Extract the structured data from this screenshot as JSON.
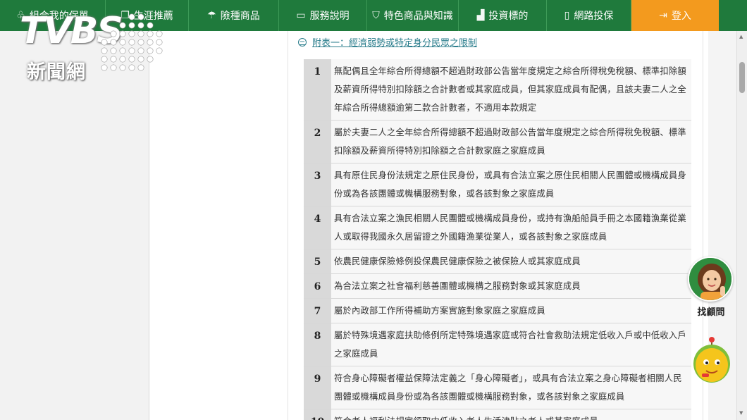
{
  "nav": {
    "items": [
      {
        "label": "組合我的保單",
        "icon": "people-icon",
        "width": 150
      },
      {
        "label": "生涯推薦",
        "icon": "book-icon",
        "width": 118
      },
      {
        "label": "險種商品",
        "icon": "umbrella-icon",
        "width": 128
      },
      {
        "label": "服務說明",
        "icon": "card-icon",
        "width": 125
      },
      {
        "label": "特色商品與知識",
        "icon": "shield-icon",
        "width": 130
      },
      {
        "label": "投資標的",
        "icon": "chart-icon",
        "width": 125
      },
      {
        "label": "網路投保",
        "icon": "phone-icon",
        "width": 120
      }
    ],
    "login_label": "登入"
  },
  "logo": {
    "brand": "TVBS",
    "sub": "新聞網"
  },
  "appendix": {
    "title": "附表一：經濟弱勢或特定身分民眾之限制"
  },
  "table": {
    "rows": [
      {
        "num": "1",
        "text": "無配偶且全年綜合所得總額不超過財政部公告當年度規定之綜合所得稅免稅額、標準扣除額及薪資所得特別扣除額之合計數者或其家庭成員，但其家庭成員有配偶，且該夫妻二人之全年綜合所得總額逾第二款合計數者，不適用本款規定"
      },
      {
        "num": "2",
        "text": "屬於夫妻二人之全年綜合所得總額不超過財政部公告當年度規定之綜合所得稅免稅額、標準扣除額及薪資所得特別扣除額之合計數家庭之家庭成員"
      },
      {
        "num": "3",
        "text": "具有原住民身份法規定之原住民身份，或具有合法立案之原住民相關人民團體或機構成員身份或為各該團體或機構服務對象，或各該對象之家庭成員"
      },
      {
        "num": "4",
        "text": "具有合法立案之漁民相關人民團體或機構成員身份，或持有漁船船員手冊之本國籍漁業從業人或取得我國永久居留證之外國籍漁業從業人，或各該對象之家庭成員"
      },
      {
        "num": "5",
        "text": "依農民健康保險條例投保農民健康保險之被保險人或其家庭成員"
      },
      {
        "num": "6",
        "text": "為合法立案之社會福利慈善團體或機構之服務對象或其家庭成員"
      },
      {
        "num": "7",
        "text": "屬於內政部工作所得補助方案實施對象家庭之家庭成員"
      },
      {
        "num": "8",
        "text": "屬於特殊境遇家庭扶助條例所定特殊境遇家庭或符合社會救助法規定低收入戶或中低收入戶之家庭成員"
      },
      {
        "num": "9",
        "text": "符合身心障礙者權益保障法定義之「身心障礙者」，或具有合法立案之身心障礙者相關人民團體或機構成員身份或為各該團體或機構服務對象，或各該對象之家庭成員"
      },
      {
        "num": "10",
        "text": "符合老人福利法規定領取中低收入老人生活津貼之老人或其家庭成員"
      }
    ]
  },
  "assistant": {
    "label": "找顧問"
  },
  "colors": {
    "nav_bg": "#1f7a3c",
    "login_bg": "#f39a1e",
    "link": "#2a7d8c",
    "num_bg": "#d9d9d9",
    "row_bg": "#f7f7f7"
  }
}
